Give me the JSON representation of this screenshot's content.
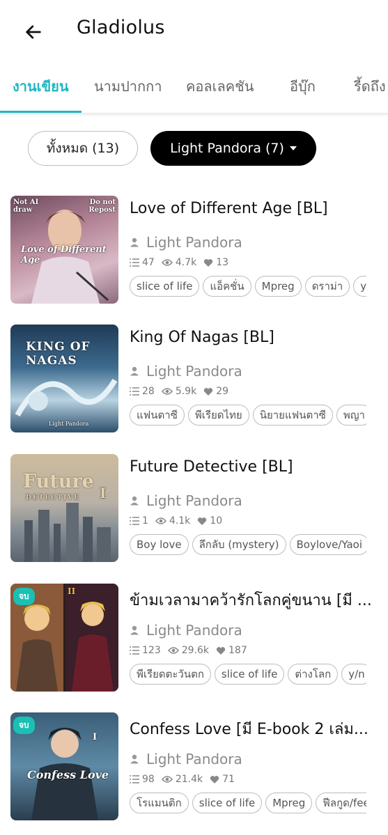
{
  "header": {
    "title": "Gladiolus"
  },
  "tabs": [
    {
      "label": "งานเขียน",
      "active": true
    },
    {
      "label": "นามปากกา"
    },
    {
      "label": "คอลเลคชัน"
    },
    {
      "label": "อีบุ๊ก"
    },
    {
      "label": "รี้ดถึง"
    }
  ],
  "filters": {
    "all_label": "ทั้งหมด (13)",
    "pen_name_label": "Light Pandora (7)"
  },
  "accent_color": "#1db7c4",
  "items": [
    {
      "title": "Love of Different Age [BL]",
      "author": "Light Pandora",
      "chapters": "47",
      "views": "4.7k",
      "likes": "13",
      "tags": [
        "slice of life",
        "แอ็คชั่น",
        "Mpreg",
        "ดราม่า",
        "y/"
      ],
      "cover_texts": [
        "Not AI draw",
        "Do not Repost",
        "Love of Different Age"
      ]
    },
    {
      "title": "King Of Nagas [BL]",
      "author": "Light Pandora",
      "chapters": "28",
      "views": "5.9k",
      "likes": "29",
      "tags": [
        "แฟนตาซี",
        "พีเรียดไทย",
        "นิยายแฟนตาซี",
        "พญา"
      ],
      "cover_texts": [
        "KING OF NAGAS",
        "Light Pandora"
      ]
    },
    {
      "title": "Future Detective [BL]",
      "author": "Light Pandora",
      "chapters": "1",
      "views": "4.1k",
      "likes": "10",
      "tags": [
        "Boy love",
        "ลึกลับ (mystery)",
        "Boylove/Yaoi"
      ],
      "cover_texts": [
        "Future",
        "DETECTIVE",
        "I"
      ]
    },
    {
      "title": "ข้ามเวลามาคว้ารักโลกคู่ขนาน [มี ...",
      "author": "Light Pandora",
      "chapters": "123",
      "views": "29.6k",
      "likes": "187",
      "badge": "จบ",
      "tags": [
        "พีเรียดตะวันตก",
        "slice of life",
        "ต่างโลก",
        "y/n"
      ],
      "cover_texts": [
        "II"
      ]
    },
    {
      "title": "Confess Love [มี E-book 2 เล่ม...",
      "author": "Light Pandora",
      "chapters": "98",
      "views": "21.4k",
      "likes": "71",
      "badge": "จบ",
      "tags": [
        "โรแมนติก",
        "slice of life",
        "Mpreg",
        "ฟีลกูด/fee"
      ],
      "cover_texts": [
        "Confess Love",
        "I"
      ]
    }
  ]
}
